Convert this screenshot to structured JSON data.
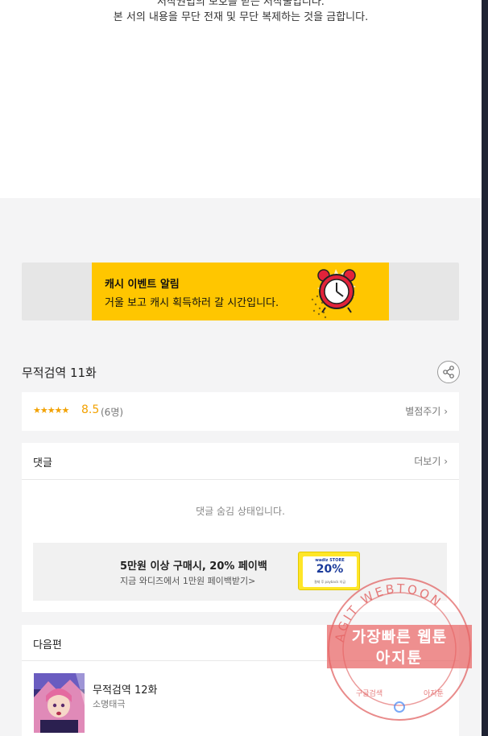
{
  "copyright": {
    "line1": "저작권법의 보호를 받는 저작물입니다.",
    "line2": "본 서의 내용을 무단 전재 및 무단 복제하는 것을 금합니다."
  },
  "banner": {
    "title": "캐시 이벤트 알림",
    "text": "거울 보고 캐시 획득하러 갈 시간입니다.",
    "icon": "alarm-clock-icon",
    "color": "#ffc600"
  },
  "episode": {
    "title": "무적검역 11화",
    "share_icon": "share-icon"
  },
  "rating": {
    "stars": "★★★★★",
    "score": "8.5",
    "count": "(6명)",
    "rate_link": "별점주기",
    "star_color": "#f2a100"
  },
  "comments": {
    "heading": "댓글",
    "more": "더보기",
    "hidden_message": "댓글 숨김 상태입니다."
  },
  "ad": {
    "title": "5만원 이상 구매시, 20% 페이백",
    "subtitle": "지금 와디즈에서 1만원 페이백받기>",
    "coupon_brand": "wadiz STORE",
    "coupon_percent": "20%",
    "coupon_fine": "결제 후 payback 지급"
  },
  "next": {
    "heading": "다음편",
    "episode_title": "무적검역 12화",
    "author": "소명태극"
  },
  "watermark": {
    "ring_text": "AGIT WEBTOON",
    "line1": "가장빠른 웹툰",
    "line2": "아지툰",
    "bottom_left": "구글검색",
    "bottom_right": "아지툰"
  }
}
